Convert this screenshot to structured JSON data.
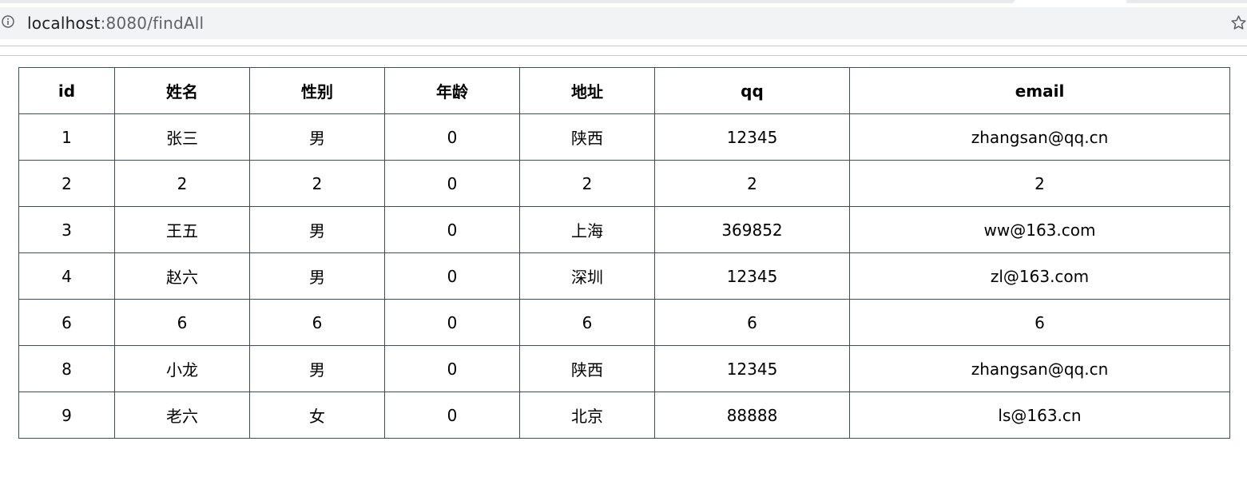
{
  "browser": {
    "url_host": "localhost",
    "url_path": ":8080/findAll",
    "info_icon": "info-icon",
    "bookmark_icon": "star-icon"
  },
  "table": {
    "headers": [
      "id",
      "姓名",
      "性别",
      "年龄",
      "地址",
      "qq",
      "email"
    ],
    "rows": [
      [
        "1",
        "张三",
        "男",
        "0",
        "陕西",
        "12345",
        "zhangsan@qq.cn"
      ],
      [
        "2",
        "2",
        "2",
        "0",
        "2",
        "2",
        "2"
      ],
      [
        "3",
        "王五",
        "男",
        "0",
        "上海",
        "369852",
        "ww@163.com"
      ],
      [
        "4",
        "赵六",
        "男",
        "0",
        "深圳",
        "12345",
        "zl@163.com"
      ],
      [
        "6",
        "6",
        "6",
        "0",
        "6",
        "6",
        "6"
      ],
      [
        "8",
        "小龙",
        "男",
        "0",
        "陕西",
        "12345",
        "zhangsan@qq.cn"
      ],
      [
        "9",
        "老六",
        "女",
        "0",
        "北京",
        "88888",
        "ls@163.cn"
      ]
    ]
  }
}
